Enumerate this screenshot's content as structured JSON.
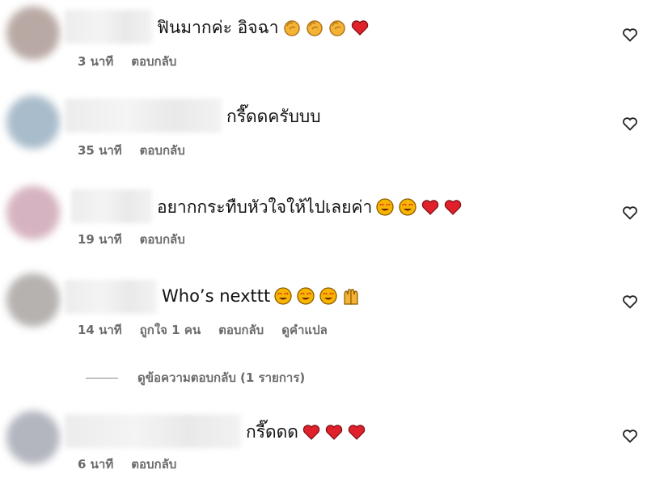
{
  "comments": [
    {
      "text": "ฟินมากค่ะ อิจฉา",
      "emojis": [
        "clap-emoji",
        "clap-emoji",
        "clap-emoji",
        "red-heart-emoji"
      ],
      "time": "3 นาที",
      "reply": "ตอบกลับ",
      "avatar_color": "#b9a9a4"
    },
    {
      "text": "กรี๊ดดครับบบ",
      "emojis": [],
      "time": "35 นาที",
      "reply": "ตอบกลับ",
      "avatar_color": "#a9bccb"
    },
    {
      "text": "อยากกระทืบหัวใจให้ไปเลยค่า",
      "emojis": [
        "heart-eyes-emoji",
        "heart-eyes-emoji",
        "red-heart-emoji",
        "red-heart-emoji"
      ],
      "time": "19 นาที",
      "reply": "ตอบกลับ",
      "avatar_color": "#d6b3c0"
    },
    {
      "text": "Who’s nexttt",
      "emojis": [
        "heart-eyes-emoji",
        "heart-eyes-emoji",
        "heart-eyes-emoji",
        "raising-hands-emoji"
      ],
      "time": "14 นาที",
      "likes": "ถูกใจ 1 คน",
      "reply": "ตอบกลับ",
      "translate": "ดูคำแปล",
      "avatar_color": "#b5b2b0"
    },
    {
      "text": "กรี๊ดดด",
      "emojis": [
        "red-heart-emoji",
        "red-heart-emoji",
        "red-heart-emoji"
      ],
      "time": "6 นาที",
      "reply": "ตอบกลับ",
      "avatar_color": "#b3b6bf"
    }
  ],
  "view_replies": "ดูข้อความตอบกลับ (1 รายการ)",
  "colors": {
    "meta_text": "#6b6b6b",
    "heart": "#e0212b",
    "emoji_yellow": "#f7b500"
  }
}
